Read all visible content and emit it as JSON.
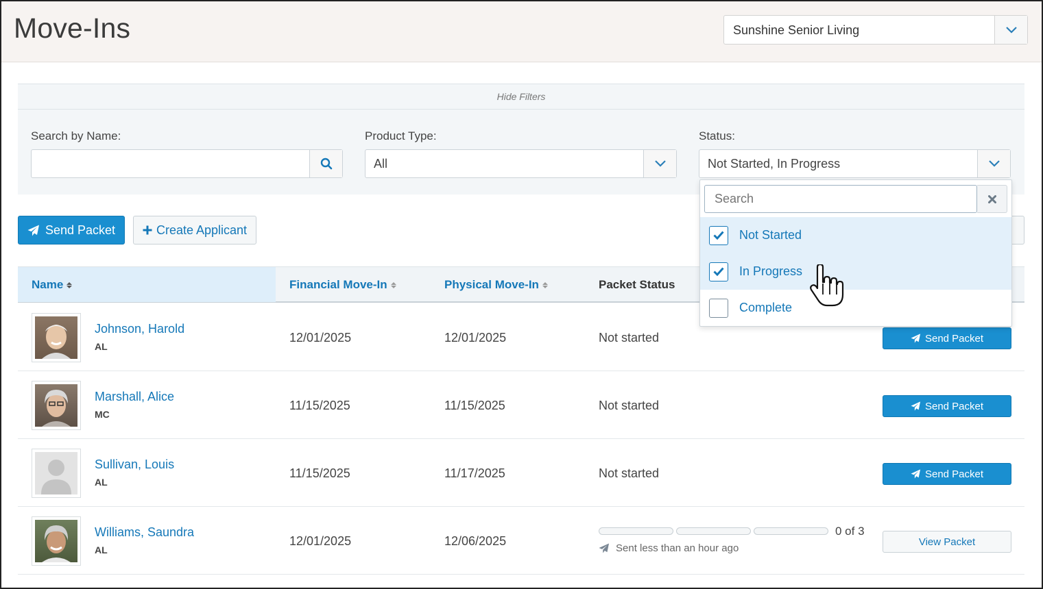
{
  "header": {
    "title": "Move-Ins",
    "community": "Sunshine Senior Living"
  },
  "filters": {
    "toggle_label": "Hide Filters",
    "search_label": "Search by Name:",
    "search_value": "",
    "product_type_label": "Product Type:",
    "product_type_value": "All",
    "status_label": "Status:",
    "status_value": "Not Started, In Progress"
  },
  "actions": {
    "send_packet": "Send Packet",
    "create_applicant": "Create Applicant"
  },
  "table": {
    "columns": {
      "name": "Name",
      "financial": "Financial Move-In",
      "physical": "Physical Move-In",
      "packet_status": "Packet Status"
    },
    "rows": [
      {
        "name": "Johnson, Harold",
        "care": "AL",
        "financial": "12/01/2025",
        "physical": "12/01/2025",
        "status": "Not started",
        "action": "Send Packet"
      },
      {
        "name": "Marshall, Alice",
        "care": "MC",
        "financial": "11/15/2025",
        "physical": "11/15/2025",
        "status": "Not started",
        "action": "Send Packet"
      },
      {
        "name": "Sullivan, Louis",
        "care": "AL",
        "financial": "11/15/2025",
        "physical": "11/17/2025",
        "status": "Not started",
        "action": "Send Packet"
      },
      {
        "name": "Williams, Saundra",
        "care": "AL",
        "financial": "12/01/2025",
        "physical": "12/06/2025",
        "progress_text": "0 of 3",
        "sent_text": "Sent less than an hour ago",
        "action": "View Packet"
      }
    ]
  },
  "status_dropdown": {
    "search_placeholder": "Search",
    "options": [
      {
        "label": "Not Started",
        "checked": true
      },
      {
        "label": "In Progress",
        "checked": true
      },
      {
        "label": "Complete",
        "checked": false
      }
    ]
  },
  "colors": {
    "accent": "#1a8fd0",
    "link": "#1578b8",
    "header_bg": "#f7f3f1",
    "filters_bg": "#f3f6f8"
  }
}
